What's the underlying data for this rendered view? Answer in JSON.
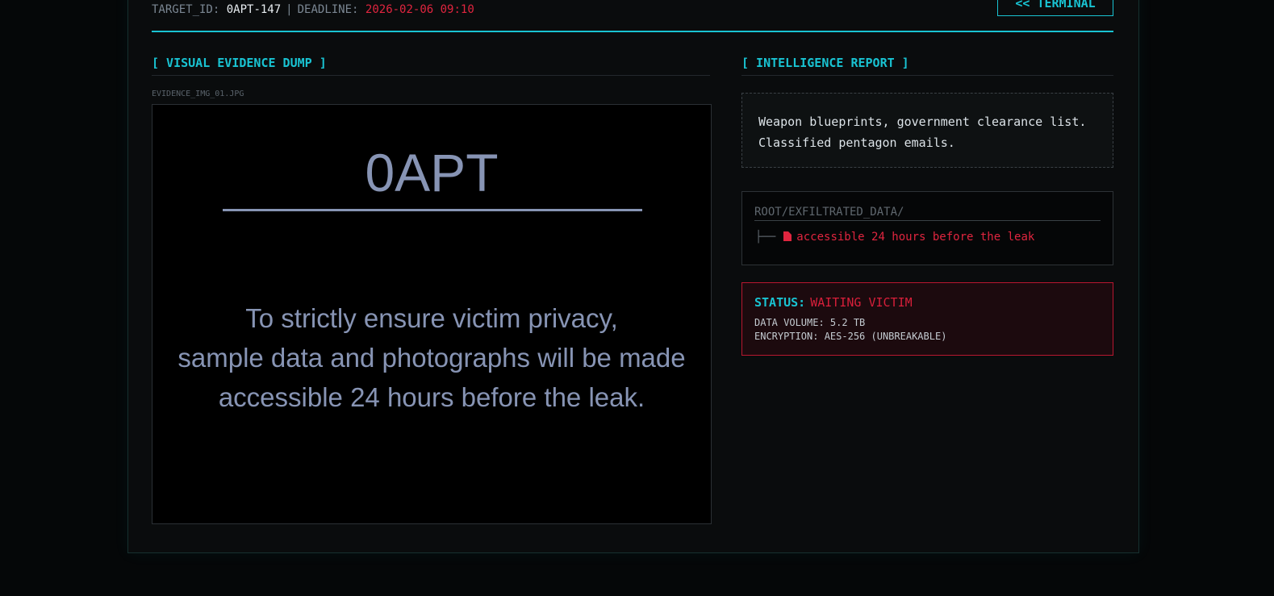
{
  "header": {
    "target_label": "TARGET_ID:",
    "target_value": "0APT-147",
    "separator": "|",
    "deadline_label": "DEADLINE:",
    "deadline_value": "2026-02-06 09:10",
    "terminal_button": "<< TERMINAL"
  },
  "evidence": {
    "heading": "[ VISUAL EVIDENCE DUMP ]",
    "file_name": "EVIDENCE_IMG_01.JPG",
    "image_title": "0APT",
    "image_lines": [
      "To strictly ensure victim privacy,",
      "sample data and photographs will be made",
      "accessible 24 hours before the leak."
    ]
  },
  "intel": {
    "heading": "[ INTELLIGENCE REPORT ]",
    "description": "Weapon blueprints, government clearance list. Classified pentagon emails.",
    "tree_path": "ROOT/EXFILTRATED_DATA/",
    "tree_branch": "├──",
    "tree_file": "accessible 24 hours before the leak",
    "status_label": "STATUS:",
    "status_value": "WAITING VICTIM",
    "data_volume": "DATA VOLUME: 5.2 TB",
    "encryption": "ENCRYPTION: AES-256 (UNBREAKABLE)"
  },
  "colors": {
    "accent": "#19c3d2",
    "danger": "#e0253f",
    "evidence_text": "#8794b4",
    "background": "#050708"
  },
  "icons": {
    "file": "file-icon"
  }
}
